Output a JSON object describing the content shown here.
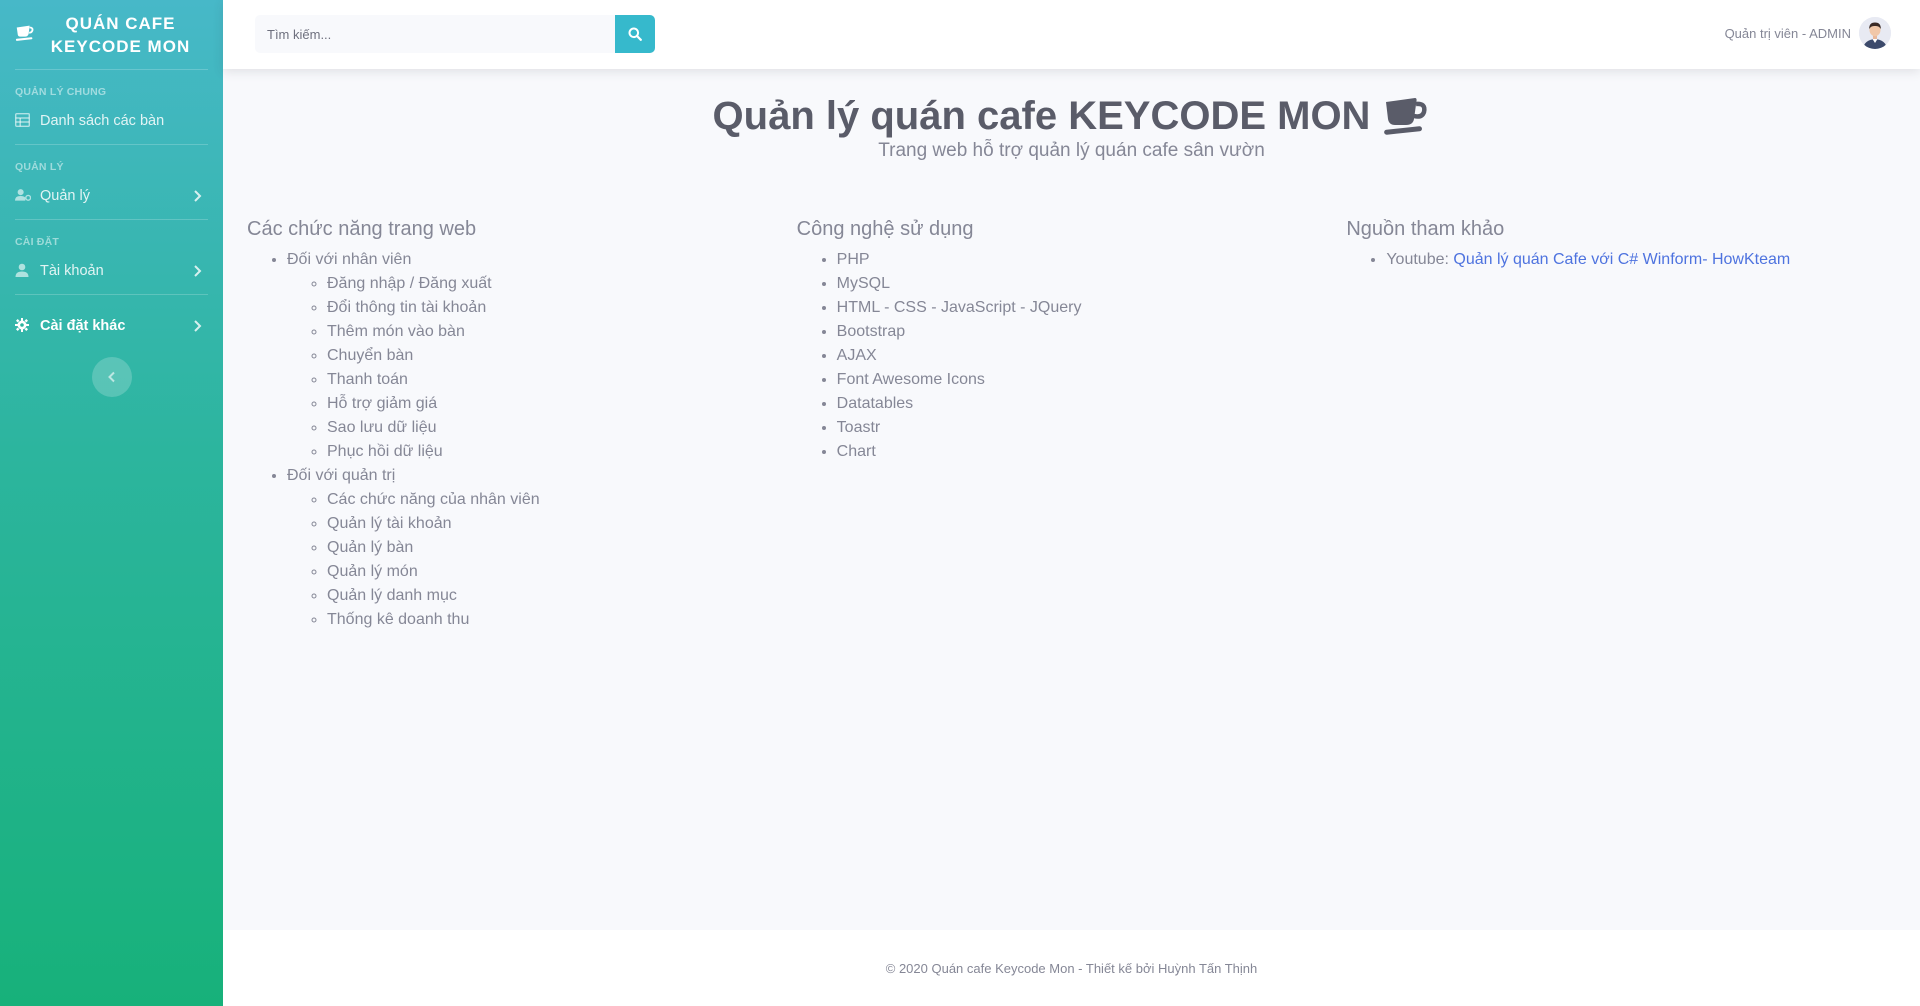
{
  "sidebar": {
    "brand": "QUÁN CAFE KEYCODE MON",
    "sections": [
      {
        "heading": "QUẢN LÝ CHUNG",
        "item": "Danh sách các bàn"
      },
      {
        "heading": "QUẢN LÝ",
        "item": "Quản lý"
      },
      {
        "heading": "CÀI ĐẶT",
        "item": "Tài khoản"
      }
    ],
    "extra_item": "Cài đặt khác"
  },
  "topbar": {
    "search_placeholder": "Tìm kiếm...",
    "user_label": "Quản trị viên - ADMIN"
  },
  "main": {
    "title": "Quản lý quán cafe KEYCODE MON",
    "subtitle": "Trang web hỗ trợ quản lý quán cafe sân vườn",
    "features": {
      "heading": "Các chức năng trang web",
      "groups": [
        {
          "label": "Đối với nhân viên",
          "items": [
            "Đăng nhập / Đăng xuất",
            "Đổi thông tin tài khoản",
            "Thêm món vào bàn",
            "Chuyển bàn",
            "Thanh toán",
            "Hỗ trợ giảm giá",
            "Sao lưu dữ liệu",
            "Phục hồi dữ liệu"
          ]
        },
        {
          "label": "Đối với quản trị",
          "items": [
            "Các chức năng của nhân viên",
            "Quản lý tài khoản",
            "Quản lý bàn",
            "Quản lý món",
            "Quản lý danh mục",
            "Thống kê doanh thu"
          ]
        }
      ]
    },
    "tech": {
      "heading": "Công nghệ sử dụng",
      "items": [
        "PHP",
        "MySQL",
        "HTML - CSS - JavaScript - JQuery",
        "Bootstrap",
        "AJAX",
        "Font Awesome Icons",
        "Datatables",
        "Toastr",
        "Chart"
      ]
    },
    "refs": {
      "heading": "Nguồn tham khảo",
      "prefix": "Youtube: ",
      "link_text": "Quản lý quán Cafe với C# Winform- HowKteam"
    }
  },
  "footer": {
    "text": "© 2020 Quán cafe Keycode Mon - Thiết kế bởi Huỳnh Tấn Thịnh"
  },
  "colors": {
    "accent": "#36b9cc",
    "link": "#4e73df",
    "sidebar_top": "#47b8c8",
    "sidebar_bottom": "#17b17a"
  }
}
